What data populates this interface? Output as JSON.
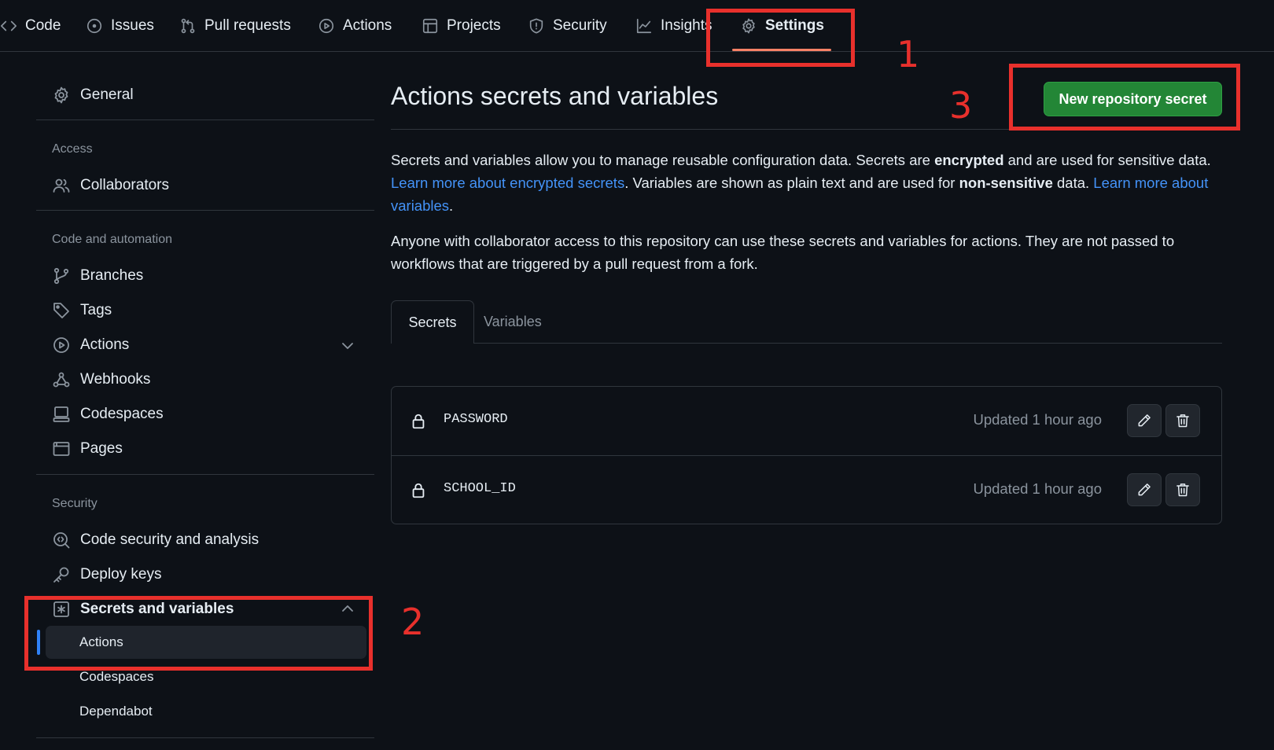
{
  "nav": {
    "tabs": [
      {
        "label": "Code",
        "icon": "code-icon"
      },
      {
        "label": "Issues",
        "icon": "issue-opened-icon"
      },
      {
        "label": "Pull requests",
        "icon": "git-pull-request-icon"
      },
      {
        "label": "Actions",
        "icon": "play-icon"
      },
      {
        "label": "Projects",
        "icon": "table-icon"
      },
      {
        "label": "Security",
        "icon": "shield-icon"
      },
      {
        "label": "Insights",
        "icon": "graph-icon"
      },
      {
        "label": "Settings",
        "icon": "gear-icon",
        "active": true
      }
    ]
  },
  "sidebar": {
    "general": "General",
    "access_heading": "Access",
    "collaborators": "Collaborators",
    "code_heading": "Code and automation",
    "branches": "Branches",
    "tags": "Tags",
    "actions": "Actions",
    "webhooks": "Webhooks",
    "codespaces": "Codespaces",
    "pages": "Pages",
    "security_heading": "Security",
    "code_security": "Code security and analysis",
    "deploy_keys": "Deploy keys",
    "secrets_variables": "Secrets and variables",
    "sub_actions": "Actions",
    "sub_codespaces": "Codespaces",
    "sub_dependabot": "Dependabot"
  },
  "main": {
    "title": "Actions secrets and variables",
    "new_secret_button": "New repository secret",
    "intro": {
      "p1_a": "Secrets and variables allow you to manage reusable configuration data. Secrets are ",
      "p1_b": "encrypted",
      "p1_c": " and are used for sensitive data. ",
      "p1_link1": "Learn more about encrypted secrets",
      "p1_d": ". Variables are shown as plain text and are used for ",
      "p1_e": "non-sensitive",
      "p1_f": " data. ",
      "p1_link2": "Learn more about variables",
      "p1_g": ".",
      "p2": "Anyone with collaborator access to this repository can use these secrets and variables for actions. They are not passed to workflows that are triggered by a pull request from a fork."
    },
    "tabs": {
      "secrets": "Secrets",
      "variables": "Variables"
    },
    "secrets": [
      {
        "name": "PASSWORD",
        "updated": "Updated 1 hour ago"
      },
      {
        "name": "SCHOOL_ID",
        "updated": "Updated 1 hour ago"
      }
    ]
  },
  "annotations": {
    "one": "1",
    "two": "2",
    "three": "3"
  },
  "colors": {
    "background": "#0d1117",
    "border": "#30363d",
    "link": "#4493f8",
    "primary_button": "#238636",
    "active_underline": "#f78166",
    "annotation": "#e8302c"
  }
}
